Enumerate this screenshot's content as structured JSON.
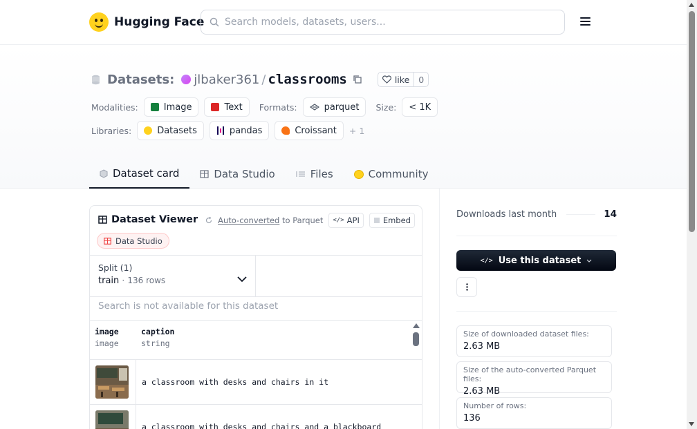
{
  "brand": {
    "name": "Hugging Face"
  },
  "search": {
    "placeholder": "Search models, datasets, users..."
  },
  "repo": {
    "kind_label": "Datasets:",
    "owner": "jlbaker361",
    "slash": "/",
    "name": "classrooms",
    "like_label": "like",
    "like_count": "0"
  },
  "meta": {
    "modalities_label": "Modalities:",
    "modalities": [
      {
        "label": "Image",
        "icon": "image-icon",
        "color": "#15803d"
      },
      {
        "label": "Text",
        "icon": "text-icon",
        "color": "#dc2626"
      }
    ],
    "formats_label": "Formats:",
    "formats": [
      {
        "label": "parquet",
        "icon": "parquet-icon"
      }
    ],
    "size_label": "Size:",
    "size_value": "< 1K",
    "libraries_label": "Libraries:",
    "libraries": [
      {
        "label": "Datasets",
        "icon": "hf-datasets-icon"
      },
      {
        "label": "pandas",
        "icon": "pandas-icon"
      },
      {
        "label": "Croissant",
        "icon": "croissant-icon"
      }
    ],
    "libraries_more": "+ 1"
  },
  "tabs": [
    {
      "label": "Dataset card",
      "icon": "dataset-card-icon",
      "active": true
    },
    {
      "label": "Data Studio",
      "icon": "table-icon",
      "active": false
    },
    {
      "label": "Files",
      "icon": "files-icon",
      "active": false
    },
    {
      "label": "Community",
      "icon": "community-icon",
      "active": false
    }
  ],
  "viewer": {
    "title": "Dataset Viewer",
    "auto_converted": "Auto-converted",
    "to_parquet": "to Parquet",
    "api_label": "API",
    "embed_label": "Embed",
    "data_studio_label": "Data Studio",
    "split_label": "Split (1)",
    "split_name": "train",
    "split_dot": "·",
    "split_rows": "136 rows",
    "search_na": "Search is not available for this dataset",
    "columns": [
      {
        "name": "image",
        "type": "image"
      },
      {
        "name": "caption",
        "type": "string"
      }
    ],
    "rows": [
      {
        "caption": "a classroom with desks and chairs in it"
      },
      {
        "caption": "a classroom with desks and chairs and a blackboard"
      }
    ]
  },
  "sidebar": {
    "downloads_label": "Downloads last month",
    "downloads_value": "14",
    "use_button": "Use this dataset",
    "stats": [
      {
        "label": "Size of downloaded dataset files:",
        "value": "2.63 MB"
      },
      {
        "label": "Size of the auto-converted Parquet files:",
        "value": "2.63 MB"
      },
      {
        "label": "Number of rows:",
        "value": "136"
      }
    ]
  }
}
